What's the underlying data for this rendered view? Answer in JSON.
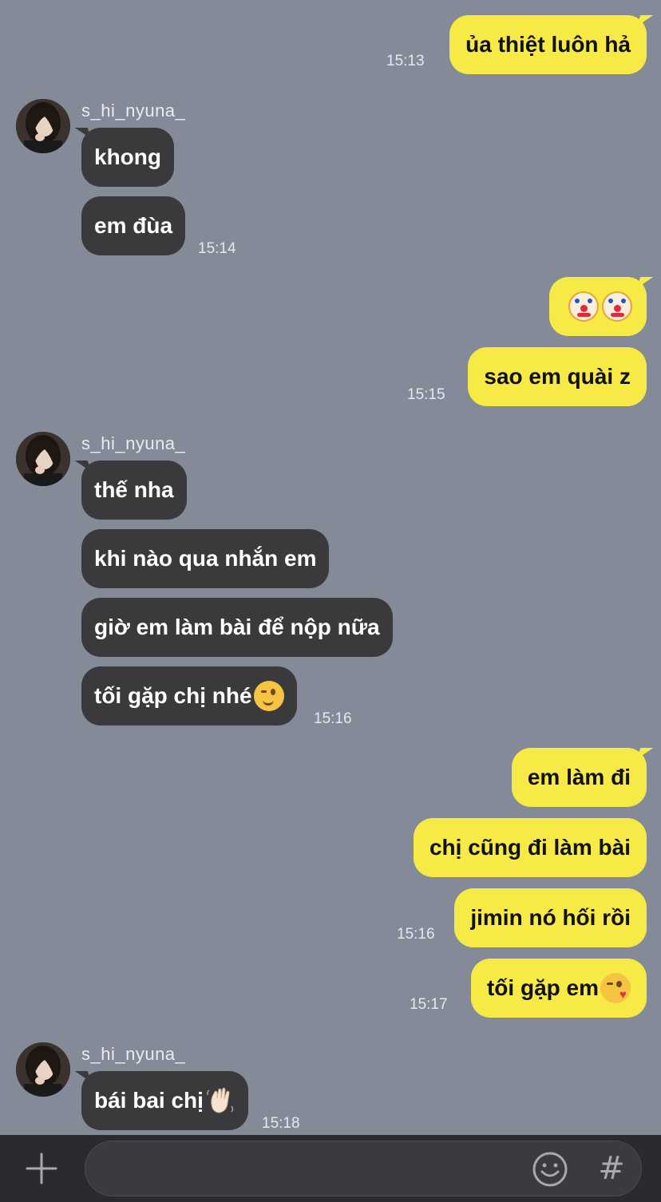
{
  "contact": {
    "name": "s_hi_nyuna_"
  },
  "messages": [
    {
      "id": "m1",
      "direction": "out",
      "text": "ủa thiệt luôn hả",
      "time": "15:13"
    },
    {
      "id": "m2",
      "direction": "in",
      "text": "khong",
      "time": ""
    },
    {
      "id": "m3",
      "direction": "in",
      "text": "em đùa",
      "time": "15:14"
    },
    {
      "id": "m4",
      "direction": "out",
      "text": "",
      "emoji": [
        "clown-face",
        "clown-face"
      ],
      "time": ""
    },
    {
      "id": "m5",
      "direction": "out",
      "text": "sao em quài z",
      "time": "15:15"
    },
    {
      "id": "m6",
      "direction": "in",
      "text": "thế nha",
      "time": ""
    },
    {
      "id": "m7",
      "direction": "in",
      "text": "khi nào qua nhắn em",
      "time": ""
    },
    {
      "id": "m8",
      "direction": "in",
      "text": "giờ em làm bài để nộp nữa",
      "time": ""
    },
    {
      "id": "m9",
      "direction": "in",
      "text": "tối gặp chị nhé",
      "emoji": [
        "winking-face"
      ],
      "time": "15:16"
    },
    {
      "id": "m10",
      "direction": "out",
      "text": "em làm đi",
      "time": ""
    },
    {
      "id": "m11",
      "direction": "out",
      "text": "chị cũng đi làm bài",
      "time": ""
    },
    {
      "id": "m12",
      "direction": "out",
      "text": "jimin nó hối rồi",
      "time": "15:16"
    },
    {
      "id": "m13",
      "direction": "out",
      "text": "tối gặp em",
      "emoji": [
        "face-blowing-kiss"
      ],
      "time": "15:17"
    },
    {
      "id": "m14",
      "direction": "in",
      "text": "bái bai chị",
      "emoji": [
        "waving-hand"
      ],
      "time": "15:18"
    }
  ],
  "composer": {
    "placeholder": "",
    "plus_icon": "plus-icon",
    "emoji_icon": "smiley-icon",
    "hashtag_icon": "hashtag-icon",
    "hashtag_glyph": "#"
  },
  "colors": {
    "background": "#848a98",
    "outgoing_bubble": "#f7ea47",
    "incoming_bubble": "#3a3a3d",
    "composer_bar": "#2a2b2e"
  }
}
